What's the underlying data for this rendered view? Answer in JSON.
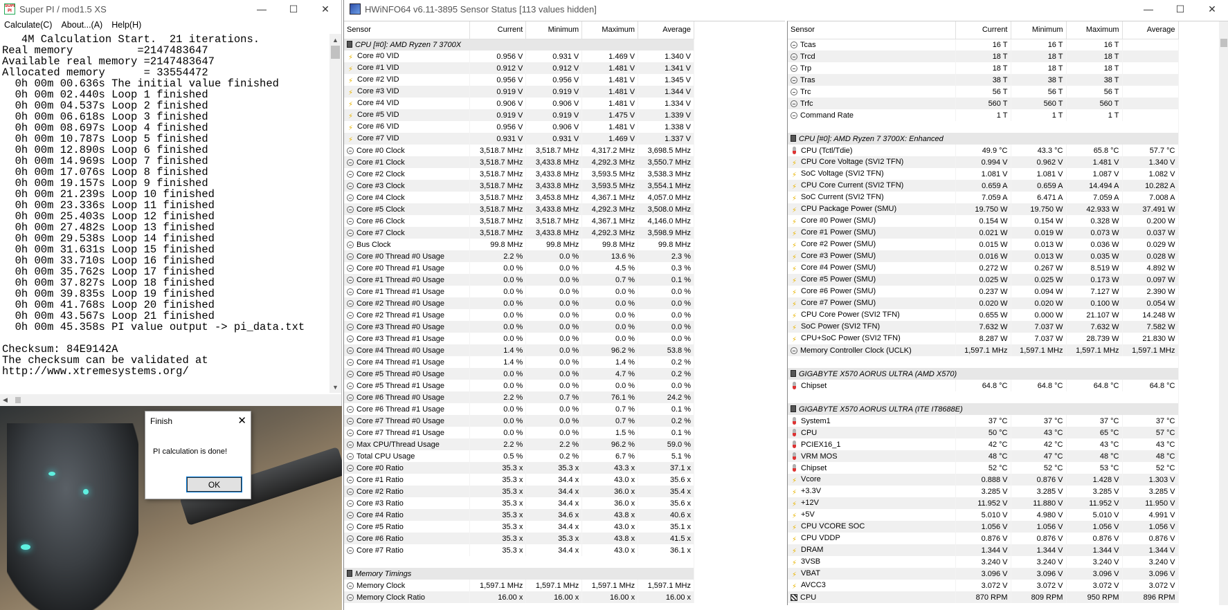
{
  "superpi": {
    "title": "Super PI / mod1.5 XS",
    "icon_text": "SUPER PI",
    "minimize": "—",
    "maximize": "☐",
    "close": "✕",
    "menu": [
      "Calculate(C)",
      "About...(A)",
      "Help(H)"
    ],
    "console_lines": [
      "   4M Calculation Start.  21 iterations.",
      "Real memory          =2147483647",
      "Available real memory =2147483647",
      "Allocated memory      = 33554472",
      "  0h 00m 00.636s The initial value finished",
      "  0h 00m 02.440s Loop 1 finished",
      "  0h 00m 04.537s Loop 2 finished",
      "  0h 00m 06.618s Loop 3 finished",
      "  0h 00m 08.697s Loop 4 finished",
      "  0h 00m 10.787s Loop 5 finished",
      "  0h 00m 12.890s Loop 6 finished",
      "  0h 00m 14.969s Loop 7 finished",
      "  0h 00m 17.076s Loop 8 finished",
      "  0h 00m 19.157s Loop 9 finished",
      "  0h 00m 21.239s Loop 10 finished",
      "  0h 00m 23.336s Loop 11 finished",
      "  0h 00m 25.403s Loop 12 finished",
      "  0h 00m 27.482s Loop 13 finished",
      "  0h 00m 29.538s Loop 14 finished",
      "  0h 00m 31.631s Loop 15 finished",
      "  0h 00m 33.710s Loop 16 finished",
      "  0h 00m 35.762s Loop 17 finished",
      "  0h 00m 37.827s Loop 18 finished",
      "  0h 00m 39.835s Loop 19 finished",
      "  0h 00m 41.768s Loop 20 finished",
      "  0h 00m 43.567s Loop 21 finished",
      "  0h 00m 45.358s PI value output -> pi_data.txt",
      "",
      "Checksum: 84E9142A",
      "The checksum can be validated at",
      "http://www.xtremesystems.org/"
    ]
  },
  "dialog": {
    "title": "Finish",
    "close": "✕",
    "message": "PI calculation is done!",
    "ok": "OK"
  },
  "hwinfo": {
    "title": "HWiNFO64 v6.11-3895 Sensor Status [113 values hidden]",
    "minimize": "—",
    "maximize": "☐",
    "close": "✕",
    "headers": [
      "Sensor",
      "Current",
      "Minimum",
      "Maximum",
      "Average"
    ],
    "left_rows": [
      {
        "t": "group",
        "label": "CPU [#0]: AMD Ryzen 7 3700X"
      },
      {
        "i": "volt",
        "s": "Core #0 VID",
        "v": [
          "0.956 V",
          "0.931 V",
          "1.469 V",
          "1.340 V"
        ]
      },
      {
        "i": "volt",
        "s": "Core #1 VID",
        "v": [
          "0.912 V",
          "0.912 V",
          "1.481 V",
          "1.341 V"
        ]
      },
      {
        "i": "volt",
        "s": "Core #2 VID",
        "v": [
          "0.956 V",
          "0.956 V",
          "1.481 V",
          "1.345 V"
        ]
      },
      {
        "i": "volt",
        "s": "Core #3 VID",
        "v": [
          "0.919 V",
          "0.919 V",
          "1.481 V",
          "1.344 V"
        ]
      },
      {
        "i": "volt",
        "s": "Core #4 VID",
        "v": [
          "0.906 V",
          "0.906 V",
          "1.481 V",
          "1.334 V"
        ]
      },
      {
        "i": "volt",
        "s": "Core #5 VID",
        "v": [
          "0.919 V",
          "0.919 V",
          "1.475 V",
          "1.339 V"
        ]
      },
      {
        "i": "volt",
        "s": "Core #6 VID",
        "v": [
          "0.956 V",
          "0.906 V",
          "1.481 V",
          "1.338 V"
        ]
      },
      {
        "i": "volt",
        "s": "Core #7 VID",
        "v": [
          "0.931 V",
          "0.931 V",
          "1.469 V",
          "1.337 V"
        ]
      },
      {
        "i": "clock",
        "s": "Core #0 Clock",
        "v": [
          "3,518.7 MHz",
          "3,518.7 MHz",
          "4,317.2 MHz",
          "3,698.5 MHz"
        ]
      },
      {
        "i": "clock",
        "s": "Core #1 Clock",
        "v": [
          "3,518.7 MHz",
          "3,433.8 MHz",
          "4,292.3 MHz",
          "3,550.7 MHz"
        ]
      },
      {
        "i": "clock",
        "s": "Core #2 Clock",
        "v": [
          "3,518.7 MHz",
          "3,433.8 MHz",
          "3,593.5 MHz",
          "3,538.3 MHz"
        ]
      },
      {
        "i": "clock",
        "s": "Core #3 Clock",
        "v": [
          "3,518.7 MHz",
          "3,433.8 MHz",
          "3,593.5 MHz",
          "3,554.1 MHz"
        ]
      },
      {
        "i": "clock",
        "s": "Core #4 Clock",
        "v": [
          "3,518.7 MHz",
          "3,453.8 MHz",
          "4,367.1 MHz",
          "4,057.0 MHz"
        ]
      },
      {
        "i": "clock",
        "s": "Core #5 Clock",
        "v": [
          "3,518.7 MHz",
          "3,433.8 MHz",
          "4,292.3 MHz",
          "3,508.0 MHz"
        ]
      },
      {
        "i": "clock",
        "s": "Core #6 Clock",
        "v": [
          "3,518.7 MHz",
          "3,518.7 MHz",
          "4,367.1 MHz",
          "4,146.0 MHz"
        ]
      },
      {
        "i": "clock",
        "s": "Core #7 Clock",
        "v": [
          "3,518.7 MHz",
          "3,433.8 MHz",
          "4,292.3 MHz",
          "3,598.9 MHz"
        ]
      },
      {
        "i": "clock",
        "s": "Bus Clock",
        "v": [
          "99.8 MHz",
          "99.8 MHz",
          "99.8 MHz",
          "99.8 MHz"
        ]
      },
      {
        "i": "clock",
        "s": "Core #0 Thread #0 Usage",
        "v": [
          "2.2 %",
          "0.0 %",
          "13.6 %",
          "2.3 %"
        ]
      },
      {
        "i": "clock",
        "s": "Core #0 Thread #1 Usage",
        "v": [
          "0.0 %",
          "0.0 %",
          "4.5 %",
          "0.3 %"
        ]
      },
      {
        "i": "clock",
        "s": "Core #1 Thread #0 Usage",
        "v": [
          "0.0 %",
          "0.0 %",
          "0.7 %",
          "0.1 %"
        ]
      },
      {
        "i": "clock",
        "s": "Core #1 Thread #1 Usage",
        "v": [
          "0.0 %",
          "0.0 %",
          "0.0 %",
          "0.0 %"
        ]
      },
      {
        "i": "clock",
        "s": "Core #2 Thread #0 Usage",
        "v": [
          "0.0 %",
          "0.0 %",
          "0.0 %",
          "0.0 %"
        ]
      },
      {
        "i": "clock",
        "s": "Core #2 Thread #1 Usage",
        "v": [
          "0.0 %",
          "0.0 %",
          "0.0 %",
          "0.0 %"
        ]
      },
      {
        "i": "clock",
        "s": "Core #3 Thread #0 Usage",
        "v": [
          "0.0 %",
          "0.0 %",
          "0.0 %",
          "0.0 %"
        ]
      },
      {
        "i": "clock",
        "s": "Core #3 Thread #1 Usage",
        "v": [
          "0.0 %",
          "0.0 %",
          "0.0 %",
          "0.0 %"
        ]
      },
      {
        "i": "clock",
        "s": "Core #4 Thread #0 Usage",
        "v": [
          "1.4 %",
          "0.0 %",
          "96.2 %",
          "53.8 %"
        ]
      },
      {
        "i": "clock",
        "s": "Core #4 Thread #1 Usage",
        "v": [
          "1.4 %",
          "0.0 %",
          "1.4 %",
          "0.2 %"
        ]
      },
      {
        "i": "clock",
        "s": "Core #5 Thread #0 Usage",
        "v": [
          "0.0 %",
          "0.0 %",
          "4.7 %",
          "0.2 %"
        ]
      },
      {
        "i": "clock",
        "s": "Core #5 Thread #1 Usage",
        "v": [
          "0.0 %",
          "0.0 %",
          "0.0 %",
          "0.0 %"
        ]
      },
      {
        "i": "clock",
        "s": "Core #6 Thread #0 Usage",
        "v": [
          "2.2 %",
          "0.7 %",
          "76.1 %",
          "24.2 %"
        ]
      },
      {
        "i": "clock",
        "s": "Core #6 Thread #1 Usage",
        "v": [
          "0.0 %",
          "0.0 %",
          "0.7 %",
          "0.1 %"
        ]
      },
      {
        "i": "clock",
        "s": "Core #7 Thread #0 Usage",
        "v": [
          "0.0 %",
          "0.0 %",
          "0.7 %",
          "0.2 %"
        ]
      },
      {
        "i": "clock",
        "s": "Core #7 Thread #1 Usage",
        "v": [
          "0.0 %",
          "0.0 %",
          "1.5 %",
          "0.1 %"
        ]
      },
      {
        "i": "clock",
        "s": "Max CPU/Thread Usage",
        "v": [
          "2.2 %",
          "2.2 %",
          "96.2 %",
          "59.0 %"
        ]
      },
      {
        "i": "clock",
        "s": "Total CPU Usage",
        "v": [
          "0.5 %",
          "0.2 %",
          "6.7 %",
          "5.1 %"
        ]
      },
      {
        "i": "clock",
        "s": "Core #0 Ratio",
        "v": [
          "35.3 x",
          "35.3 x",
          "43.3 x",
          "37.1 x"
        ]
      },
      {
        "i": "clock",
        "s": "Core #1 Ratio",
        "v": [
          "35.3 x",
          "34.4 x",
          "43.0 x",
          "35.6 x"
        ]
      },
      {
        "i": "clock",
        "s": "Core #2 Ratio",
        "v": [
          "35.3 x",
          "34.4 x",
          "36.0 x",
          "35.4 x"
        ]
      },
      {
        "i": "clock",
        "s": "Core #3 Ratio",
        "v": [
          "35.3 x",
          "34.4 x",
          "36.0 x",
          "35.6 x"
        ]
      },
      {
        "i": "clock",
        "s": "Core #4 Ratio",
        "v": [
          "35.3 x",
          "34.6 x",
          "43.8 x",
          "40.6 x"
        ]
      },
      {
        "i": "clock",
        "s": "Core #5 Ratio",
        "v": [
          "35.3 x",
          "34.4 x",
          "43.0 x",
          "35.1 x"
        ]
      },
      {
        "i": "clock",
        "s": "Core #6 Ratio",
        "v": [
          "35.3 x",
          "35.3 x",
          "43.8 x",
          "41.5 x"
        ]
      },
      {
        "i": "clock",
        "s": "Core #7 Ratio",
        "v": [
          "35.3 x",
          "34.4 x",
          "43.0 x",
          "36.1 x"
        ]
      },
      {
        "t": "blank"
      },
      {
        "t": "group",
        "label": "Memory Timings"
      },
      {
        "i": "clock",
        "s": "Memory Clock",
        "v": [
          "1,597.1 MHz",
          "1,597.1 MHz",
          "1,597.1 MHz",
          "1,597.1 MHz"
        ]
      },
      {
        "i": "clock",
        "s": "Memory Clock Ratio",
        "v": [
          "16.00 x",
          "16.00 x",
          "16.00 x",
          "16.00 x"
        ]
      }
    ],
    "right_rows": [
      {
        "i": "clock",
        "s": "Tcas",
        "v": [
          "16 T",
          "16 T",
          "16 T",
          ""
        ]
      },
      {
        "i": "clock",
        "s": "Trcd",
        "v": [
          "18 T",
          "18 T",
          "18 T",
          ""
        ]
      },
      {
        "i": "clock",
        "s": "Trp",
        "v": [
          "18 T",
          "18 T",
          "18 T",
          ""
        ]
      },
      {
        "i": "clock",
        "s": "Tras",
        "v": [
          "38 T",
          "38 T",
          "38 T",
          ""
        ]
      },
      {
        "i": "clock",
        "s": "Trc",
        "v": [
          "56 T",
          "56 T",
          "56 T",
          ""
        ]
      },
      {
        "i": "clock",
        "s": "Trfc",
        "v": [
          "560 T",
          "560 T",
          "560 T",
          ""
        ]
      },
      {
        "i": "clock",
        "s": "Command Rate",
        "v": [
          "1 T",
          "1 T",
          "1 T",
          ""
        ]
      },
      {
        "t": "blank"
      },
      {
        "t": "group",
        "label": "CPU [#0]: AMD Ryzen 7 3700X: Enhanced"
      },
      {
        "i": "temp",
        "s": "CPU (Tctl/Tdie)",
        "v": [
          "49.9 °C",
          "43.3 °C",
          "65.8 °C",
          "57.7 °C"
        ]
      },
      {
        "i": "volt",
        "s": "CPU Core Voltage (SVI2 TFN)",
        "v": [
          "0.994 V",
          "0.962 V",
          "1.481 V",
          "1.340 V"
        ]
      },
      {
        "i": "volt",
        "s": "SoC Voltage (SVI2 TFN)",
        "v": [
          "1.081 V",
          "1.081 V",
          "1.087 V",
          "1.082 V"
        ]
      },
      {
        "i": "volt",
        "s": "CPU Core Current (SVI2 TFN)",
        "v": [
          "0.659 A",
          "0.659 A",
          "14.494 A",
          "10.282 A"
        ]
      },
      {
        "i": "volt",
        "s": "SoC Current (SVI2 TFN)",
        "v": [
          "7.059 A",
          "6.471 A",
          "7.059 A",
          "7.008 A"
        ]
      },
      {
        "i": "volt",
        "s": "CPU Package Power (SMU)",
        "v": [
          "19.750 W",
          "19.750 W",
          "42.933 W",
          "37.491 W"
        ]
      },
      {
        "i": "volt",
        "s": "Core #0 Power (SMU)",
        "v": [
          "0.154 W",
          "0.154 W",
          "0.328 W",
          "0.200 W"
        ]
      },
      {
        "i": "volt",
        "s": "Core #1 Power (SMU)",
        "v": [
          "0.021 W",
          "0.019 W",
          "0.073 W",
          "0.037 W"
        ]
      },
      {
        "i": "volt",
        "s": "Core #2 Power (SMU)",
        "v": [
          "0.015 W",
          "0.013 W",
          "0.036 W",
          "0.029 W"
        ]
      },
      {
        "i": "volt",
        "s": "Core #3 Power (SMU)",
        "v": [
          "0.016 W",
          "0.013 W",
          "0.035 W",
          "0.028 W"
        ]
      },
      {
        "i": "volt",
        "s": "Core #4 Power (SMU)",
        "v": [
          "0.272 W",
          "0.267 W",
          "8.519 W",
          "4.892 W"
        ]
      },
      {
        "i": "volt",
        "s": "Core #5 Power (SMU)",
        "v": [
          "0.025 W",
          "0.025 W",
          "0.173 W",
          "0.097 W"
        ]
      },
      {
        "i": "volt",
        "s": "Core #6 Power (SMU)",
        "v": [
          "0.237 W",
          "0.094 W",
          "7.127 W",
          "2.390 W"
        ]
      },
      {
        "i": "volt",
        "s": "Core #7 Power (SMU)",
        "v": [
          "0.020 W",
          "0.020 W",
          "0.100 W",
          "0.054 W"
        ]
      },
      {
        "i": "volt",
        "s": "CPU Core Power (SVI2 TFN)",
        "v": [
          "0.655 W",
          "0.000 W",
          "21.107 W",
          "14.248 W"
        ]
      },
      {
        "i": "volt",
        "s": "SoC Power (SVI2 TFN)",
        "v": [
          "7.632 W",
          "7.037 W",
          "7.632 W",
          "7.582 W"
        ]
      },
      {
        "i": "volt",
        "s": "CPU+SoC Power (SVI2 TFN)",
        "v": [
          "8.287 W",
          "7.037 W",
          "28.739 W",
          "21.830 W"
        ]
      },
      {
        "i": "clock",
        "s": "Memory Controller Clock (UCLK)",
        "v": [
          "1,597.1 MHz",
          "1,597.1 MHz",
          "1,597.1 MHz",
          "1,597.1 MHz"
        ]
      },
      {
        "t": "blank"
      },
      {
        "t": "group",
        "label": "GIGABYTE X570 AORUS ULTRA (AMD X570)"
      },
      {
        "i": "temp",
        "s": "Chipset",
        "v": [
          "64.8 °C",
          "64.8 °C",
          "64.8 °C",
          "64.8 °C"
        ]
      },
      {
        "t": "blank"
      },
      {
        "t": "group",
        "label": "GIGABYTE X570 AORUS ULTRA (ITE IT8688E)"
      },
      {
        "i": "temp",
        "s": "System1",
        "v": [
          "37 °C",
          "37 °C",
          "37 °C",
          "37 °C"
        ]
      },
      {
        "i": "temp",
        "s": "CPU",
        "v": [
          "50 °C",
          "43 °C",
          "65 °C",
          "57 °C"
        ]
      },
      {
        "i": "temp",
        "s": "PCIEX16_1",
        "v": [
          "42 °C",
          "42 °C",
          "43 °C",
          "43 °C"
        ]
      },
      {
        "i": "temp",
        "s": "VRM MOS",
        "v": [
          "48 °C",
          "47 °C",
          "48 °C",
          "48 °C"
        ]
      },
      {
        "i": "temp",
        "s": "Chipset",
        "v": [
          "52 °C",
          "52 °C",
          "53 °C",
          "52 °C"
        ]
      },
      {
        "i": "volt",
        "s": "Vcore",
        "v": [
          "0.888 V",
          "0.876 V",
          "1.428 V",
          "1.303 V"
        ]
      },
      {
        "i": "volt",
        "s": "+3.3V",
        "v": [
          "3.285 V",
          "3.285 V",
          "3.285 V",
          "3.285 V"
        ]
      },
      {
        "i": "volt",
        "s": "+12V",
        "v": [
          "11.952 V",
          "11.880 V",
          "11.952 V",
          "11.950 V"
        ]
      },
      {
        "i": "volt",
        "s": "+5V",
        "v": [
          "5.010 V",
          "4.980 V",
          "5.010 V",
          "4.991 V"
        ]
      },
      {
        "i": "volt",
        "s": "CPU VCORE SOC",
        "v": [
          "1.056 V",
          "1.056 V",
          "1.056 V",
          "1.056 V"
        ]
      },
      {
        "i": "volt",
        "s": "CPU VDDP",
        "v": [
          "0.876 V",
          "0.876 V",
          "0.876 V",
          "0.876 V"
        ]
      },
      {
        "i": "volt",
        "s": "DRAM",
        "v": [
          "1.344 V",
          "1.344 V",
          "1.344 V",
          "1.344 V"
        ]
      },
      {
        "i": "volt",
        "s": "3VSB",
        "v": [
          "3.240 V",
          "3.240 V",
          "3.240 V",
          "3.240 V"
        ]
      },
      {
        "i": "volt",
        "s": "VBAT",
        "v": [
          "3.096 V",
          "3.096 V",
          "3.096 V",
          "3.096 V"
        ]
      },
      {
        "i": "volt",
        "s": "AVCC3",
        "v": [
          "3.072 V",
          "3.072 V",
          "3.072 V",
          "3.072 V"
        ]
      },
      {
        "i": "fan",
        "s": "CPU",
        "v": [
          "870 RPM",
          "809 RPM",
          "950 RPM",
          "896 RPM"
        ]
      }
    ]
  }
}
